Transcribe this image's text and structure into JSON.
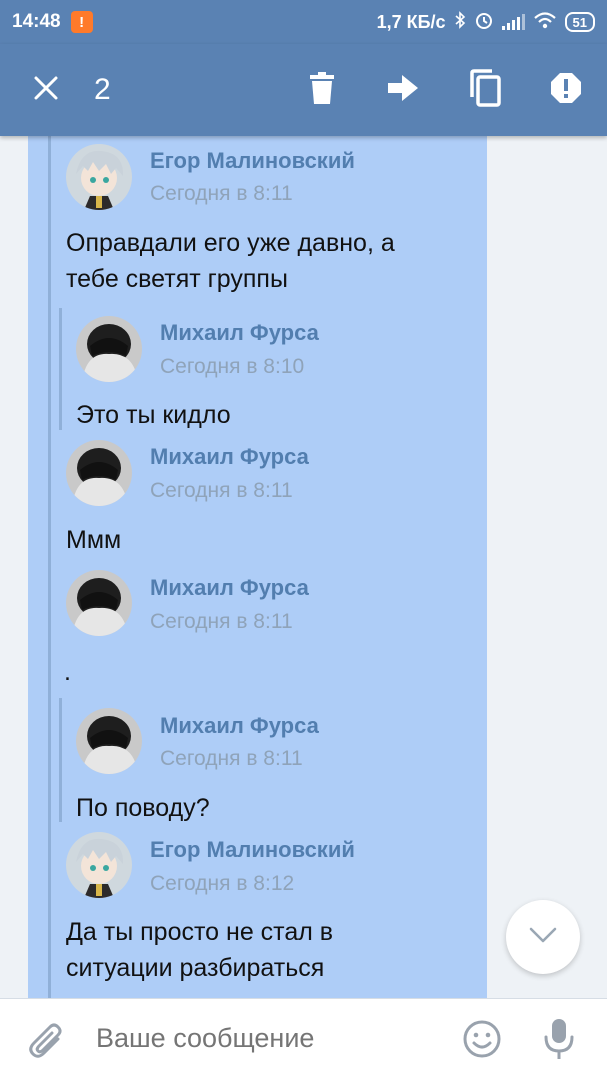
{
  "status_bar": {
    "time": "14:48",
    "notification_badge": "!",
    "net_speed": "1,7 КБ/с",
    "battery": "51"
  },
  "toolbar": {
    "selected_count": "2",
    "icons": [
      "close-icon",
      "trash-icon",
      "forward-icon",
      "copy-icon",
      "report-icon"
    ]
  },
  "messages": [
    {
      "author": "Егор Малиновский",
      "date": "Сегодня в 8:11",
      "text": [
        "Оправдали его уже давно, а",
        "тебе светят группы"
      ],
      "avatar": "anime-avatar"
    },
    {
      "author": "Михаил Фурса",
      "date": "Сегодня в 8:10",
      "text": [
        "Это ты кидло"
      ],
      "avatar": "hoodie-avatar"
    },
    {
      "author": "Михаил Фурса",
      "date": "Сегодня в 8:11",
      "text": [
        "Ммм"
      ],
      "avatar": "hoodie-avatar"
    },
    {
      "author": "Михаил Фурса",
      "date": "Сегодня в 8:11",
      "text": [
        "."
      ],
      "avatar": "hoodie-avatar"
    },
    {
      "author": "Михаил Фурса",
      "date": "Сегодня в 8:11",
      "text": [
        "По поводу?"
      ],
      "avatar": "hoodie-avatar"
    },
    {
      "author": "Егор Малиновский",
      "date": "Сегодня в 8:12",
      "text": [
        "Да ты просто не стал в",
        "ситуации разбираться"
      ],
      "avatar": "anime-avatar"
    }
  ],
  "composer": {
    "placeholder": "Ваше сообщение"
  },
  "colors": {
    "header": "#5a82b3",
    "selection": "#aecdf7",
    "author": "#527eaf"
  }
}
